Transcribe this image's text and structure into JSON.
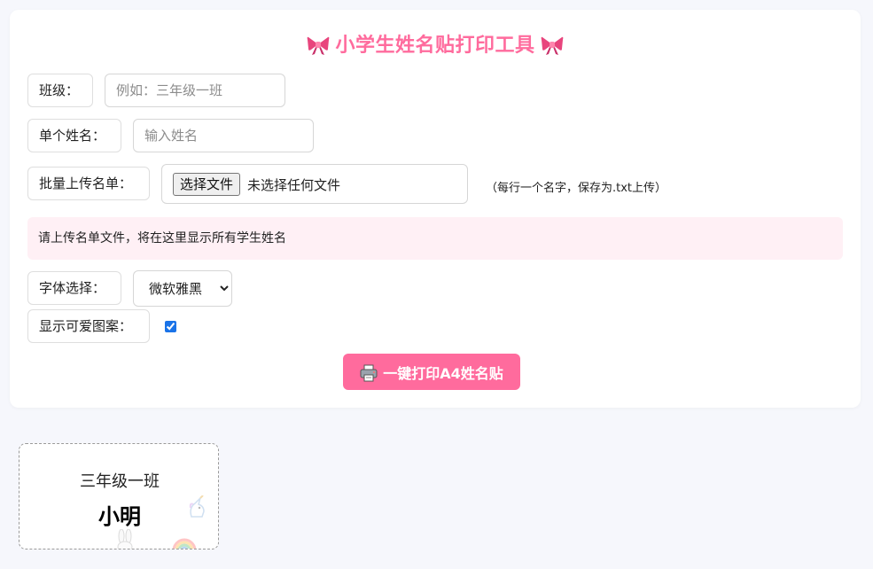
{
  "header": {
    "title": "小学生姓名贴打印工具",
    "left_icon": "ribbon-bow-icon",
    "right_icon": "ribbon-bow-icon"
  },
  "form": {
    "class_label": "班级：",
    "class_placeholder": "例如：三年级一班",
    "class_value": "",
    "name_label": "单个姓名：",
    "name_placeholder": "输入姓名",
    "name_value": "",
    "upload_label": "批量上传名单：",
    "file_button": "选择文件",
    "file_status": "未选择任何文件",
    "upload_hint": "（每行一个名字，保存为.txt上传）",
    "notice": "请上传名单文件，将在这里显示所有学生姓名",
    "font_label": "字体选择：",
    "font_selected": "微软雅黑",
    "pattern_label": "显示可爱图案：",
    "pattern_checked": true,
    "print_button": "一键打印A4姓名贴",
    "print_icon": "printer-icon"
  },
  "preview": {
    "class_text": "三年级一班",
    "name_text": "小明",
    "decorations": [
      "unicorn-icon",
      "rabbit-icon",
      "rainbow-icon"
    ]
  },
  "colors": {
    "accent": "#ff6b9d",
    "notice_bg": "#fff0f5",
    "page_bg": "#f6f7fc"
  }
}
